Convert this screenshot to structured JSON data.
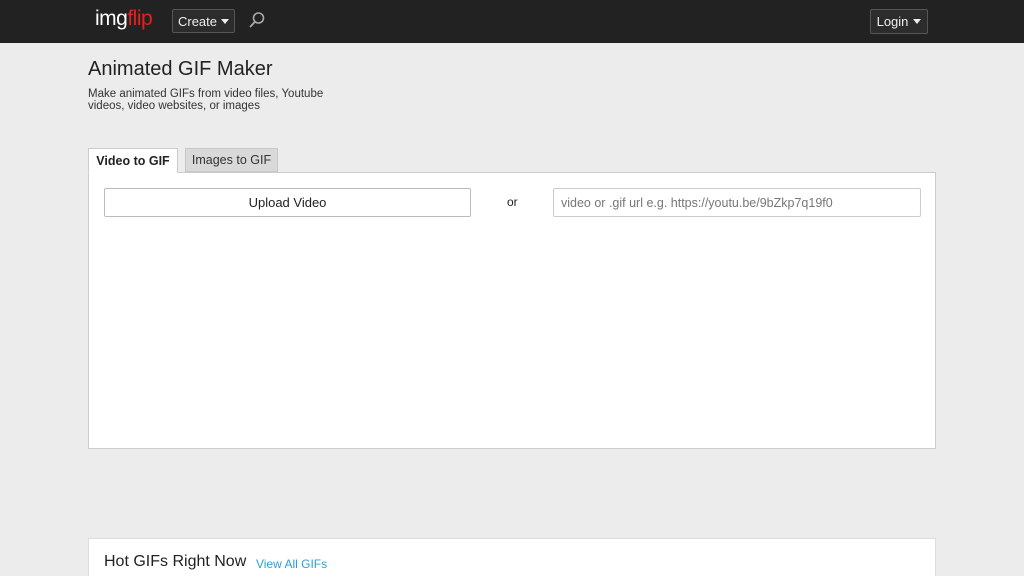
{
  "header": {
    "logo_part1": "img",
    "logo_part2": "flip",
    "create_label": "Create",
    "login_label": "Login"
  },
  "page": {
    "title": "Animated GIF Maker",
    "subtitle": "Make animated GIFs from video files, Youtube videos, video websites, or images"
  },
  "tabs": [
    {
      "label": "Video to GIF",
      "active": true
    },
    {
      "label": "Images to GIF",
      "active": false
    }
  ],
  "converter": {
    "upload_label": "Upload Video",
    "or_label": "or",
    "url_placeholder": "video or .gif url e.g. https://youtu.be/9bZkp7q19f0"
  },
  "hot_gifs": {
    "title": "Hot GIFs Right Now",
    "view_all_label": "View All GIFs"
  },
  "colors": {
    "topbar": "#222222",
    "brand_red": "#e3211e",
    "link": "#2a9fd6",
    "background": "#ececec"
  }
}
